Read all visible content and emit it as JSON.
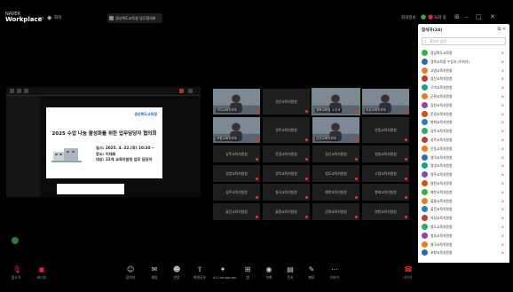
{
  "app": {
    "brand_small": "NAVER",
    "brand_big": "Workplace"
  },
  "top": {
    "title": "경상북도교육청 업무협의회",
    "left_label": "회의",
    "right_label": "회의정보",
    "right_status": "녹화 중"
  },
  "slide": {
    "logo": "경상북도교육청",
    "title": "2025 수업 나눔 활성화를 위한 업무담당자 협의회",
    "info": [
      "일시: 2025. 4. 22.(화) 10:30 ~",
      "장소: 이대회",
      "대상: 22개 교육지원청 업무 담당자"
    ]
  },
  "grid": {
    "tiles": [
      {
        "name": "구미교육지원청",
        "center": "",
        "video": true
      },
      {
        "name": "",
        "center": "경산교육지원청",
        "video": false
      },
      {
        "name": "경북교육청 수업과",
        "center": "",
        "video": true,
        "active": true
      },
      {
        "name": "의성교육지원청",
        "center": "",
        "video": true
      },
      {
        "name": "포항교육지원청",
        "center": "",
        "video": true
      },
      {
        "name": "",
        "center": "영주교육지원청",
        "video": false
      },
      {
        "name": "김천교육지원청",
        "center": "",
        "video": true
      },
      {
        "name": "",
        "center": "안동교육지원청",
        "video": false
      },
      {
        "name": "",
        "center": "상주교육지원청",
        "video": false
      },
      {
        "name": "",
        "center": "문경교육지원청",
        "video": false
      },
      {
        "name": "",
        "center": "경산교육지원청",
        "video": false
      },
      {
        "name": "",
        "center": "청송교육지원청",
        "video": false
      },
      {
        "name": "",
        "center": "영양교육지원청",
        "video": false
      },
      {
        "name": "",
        "center": "영덕교육지원청",
        "video": false
      },
      {
        "name": "",
        "center": "청도교육지원청",
        "video": false
      },
      {
        "name": "",
        "center": "고령교육지원청",
        "video": false
      },
      {
        "name": "",
        "center": "성주교육지원청",
        "video": false
      },
      {
        "name": "",
        "center": "칠곡교육지원청",
        "video": false
      },
      {
        "name": "",
        "center": "예천교육지원청",
        "video": false
      },
      {
        "name": "",
        "center": "봉화교육지원청",
        "video": false
      },
      {
        "name": "",
        "center": "울진교육지원청",
        "video": false
      },
      {
        "name": "",
        "center": "울릉교육지원청",
        "video": false
      },
      {
        "name": "",
        "center": "군위교육지원청",
        "video": false
      },
      {
        "name": "",
        "center": "영천교육지원청",
        "video": false
      }
    ]
  },
  "panel": {
    "title": "참석자(24)",
    "search_placeholder": "참석자 검색",
    "participants": [
      {
        "name": "경상북도교육청",
        "color": "#2fb344"
      },
      {
        "name": "경북교육청 수업과 (주최자)",
        "color": "#2a6bb5"
      },
      {
        "name": "고령교육지원청",
        "color": "#e67e22"
      },
      {
        "name": "경산교육지원청",
        "color": "#c0392b"
      },
      {
        "name": "구미교육지원청",
        "color": "#16a085"
      },
      {
        "name": "군위교육지원청",
        "color": "#e67e22"
      },
      {
        "name": "김천교육지원청",
        "color": "#8e44ad"
      },
      {
        "name": "문경교육지원청",
        "color": "#d35400"
      },
      {
        "name": "봉화교육지원청",
        "color": "#2980b9"
      },
      {
        "name": "상주교육지원청",
        "color": "#27ae60"
      },
      {
        "name": "성주교육지원청",
        "color": "#c0392b"
      },
      {
        "name": "안동교육지원청",
        "color": "#e67e22"
      },
      {
        "name": "영덕교육지원청",
        "color": "#2a6bb5"
      },
      {
        "name": "영양교육지원청",
        "color": "#16a085"
      },
      {
        "name": "영주교육지원청",
        "color": "#8e44ad"
      },
      {
        "name": "영천교육지원청",
        "color": "#d35400"
      },
      {
        "name": "예천교육지원청",
        "color": "#2fb344"
      },
      {
        "name": "울릉교육지원청",
        "color": "#e67e22"
      },
      {
        "name": "울진교육지원청",
        "color": "#2980b9"
      },
      {
        "name": "의성교육지원청",
        "color": "#c0392b"
      },
      {
        "name": "청도교육지원청",
        "color": "#27ae60"
      },
      {
        "name": "청송교육지원청",
        "color": "#8e44ad"
      },
      {
        "name": "칠곡교육지원청",
        "color": "#e67e22"
      },
      {
        "name": "포항교육지원청",
        "color": "#2a6bb5"
      }
    ],
    "invite_label": "초대",
    "mute_all_label": "전원 음소거 해제"
  },
  "bottom": {
    "items": [
      {
        "label": "음소거",
        "icon": "mic-off-icon",
        "glyph": "🎙",
        "red": true
      },
      {
        "label": "비디오",
        "icon": "video-off-icon",
        "glyph": "▣",
        "red": true
      },
      {
        "label": "참석자",
        "icon": "people-icon",
        "glyph": "☺",
        "red": false
      },
      {
        "label": "채팅",
        "icon": "chat-icon",
        "glyph": "✉",
        "red": false
      },
      {
        "label": "반응",
        "icon": "reaction-icon",
        "glyph": "☻",
        "red": false
      },
      {
        "label": "화면공유",
        "icon": "share-icon",
        "glyph": "⇪",
        "red": false
      },
      {
        "label": "AI Companion",
        "icon": "ai-icon",
        "glyph": "✦",
        "red": false
      },
      {
        "label": "앱",
        "icon": "apps-icon",
        "glyph": "⊞",
        "red": false
      },
      {
        "label": "녹화",
        "icon": "record-icon",
        "glyph": "◉",
        "red": false
      },
      {
        "label": "문서",
        "icon": "docs-icon",
        "glyph": "▤",
        "red": false
      },
      {
        "label": "메모",
        "icon": "notes-icon",
        "glyph": "✎",
        "red": false
      },
      {
        "label": "더보기",
        "icon": "more-icon",
        "glyph": "⋯",
        "red": false
      }
    ],
    "leave_label": "나가기"
  }
}
